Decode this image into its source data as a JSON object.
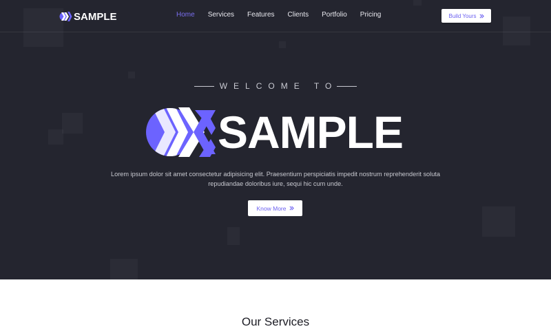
{
  "brand": {
    "name": "SAMPLE"
  },
  "nav": {
    "items": [
      {
        "label": "Home"
      },
      {
        "label": "Services"
      },
      {
        "label": "Features"
      },
      {
        "label": "Clients"
      },
      {
        "label": "Portfolio"
      },
      {
        "label": "Pricing"
      }
    ],
    "active": "Home",
    "cta_label": "Build Yours"
  },
  "hero": {
    "welcome": "WELCOME TO",
    "logo_text": "SAMPLE",
    "lead": "Lorem ipsum dolor sit amet consectetur adipisicing elit. Praesentium perspiciatis impedit nostrum reprehenderit soluta repudiandae doloribus iure, sequi hic cum unde.",
    "button_label": "Know More"
  },
  "services": {
    "title": "Our Services"
  },
  "colors": {
    "accent": "#6c63ff",
    "hero_bg": "#24252f"
  },
  "icons": {
    "cta": "double-chevron-right-icon"
  }
}
